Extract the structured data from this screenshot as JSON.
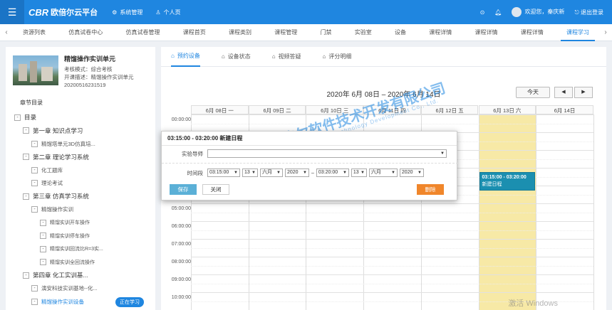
{
  "topbar": {
    "logo_mark": "CBR",
    "logo_text": "欧倍尔云平台",
    "nav": [
      {
        "icon": "gear-icon",
        "label": "系统管理"
      },
      {
        "icon": "user-icon",
        "label": "个人页"
      }
    ],
    "welcome": "欢迎您，秦庆新",
    "logout": "退出登录"
  },
  "tabs": {
    "items": [
      "资源列表",
      "仿真试卷中心",
      "仿真试卷管理",
      "课程首页",
      "课程类别",
      "课程管理",
      "门禁",
      "实验室",
      "设备",
      "课程详情",
      "课程详情",
      "课程详情",
      "课程学习"
    ],
    "active_index": 12
  },
  "course": {
    "title": "精馏操作实训单元",
    "mode_label": "考核模式：",
    "mode_value": "综合考核",
    "desc_label": "开课描述：",
    "desc_value": "精馏操作实训单元",
    "code": "20200516231519"
  },
  "toc": {
    "label": "章节目录",
    "studying_badge": "正在学习",
    "items": [
      {
        "level": 0,
        "box": "-",
        "label": "目录"
      },
      {
        "level": 1,
        "box": "-",
        "label": "第一章 知识点学习"
      },
      {
        "level": 2,
        "box": "-",
        "label": "精馏塔单元3D仿真培..."
      },
      {
        "level": 1,
        "box": "-",
        "label": "第二章 理论学习系统"
      },
      {
        "level": 2,
        "box": "-",
        "label": "化工题库"
      },
      {
        "level": 2,
        "box": "-",
        "label": "理论考试"
      },
      {
        "level": 1,
        "box": "-",
        "label": "第三章 仿真学习系统"
      },
      {
        "level": 2,
        "box": "-",
        "label": "精馏操作实训"
      },
      {
        "level": 3,
        "box": "-",
        "label": "精馏实训开车操作"
      },
      {
        "level": 3,
        "box": "-",
        "label": "精馏实训停车操作"
      },
      {
        "level": 3,
        "box": "-",
        "label": "精馏实训回流比R=3实..."
      },
      {
        "level": 3,
        "box": "-",
        "label": "精馏实训全回流操作"
      },
      {
        "level": 1,
        "box": "-",
        "label": "第四章 化工实训基..."
      },
      {
        "level": 2,
        "box": "-",
        "label": "演安科技实训基地--化..."
      },
      {
        "level": 2,
        "box": "-",
        "label": "精馏操作实训设备",
        "active": true
      }
    ]
  },
  "subtabs": [
    {
      "icon": "home-icon",
      "label": "预约设备"
    },
    {
      "icon": "home-icon",
      "label": "设备状态"
    },
    {
      "icon": "home-icon",
      "label": "视频答疑"
    },
    {
      "icon": "home-icon",
      "label": "评分明细"
    }
  ],
  "calendar": {
    "title": "2020年 6月 08日 – 2020年 6月 14日",
    "today": "今天",
    "prev": "◀",
    "next": "▶",
    "days": [
      "6月 08日 一",
      "6月 09日 二",
      "6月 10日 三",
      "6月 11日 四",
      "6月 12日 五",
      "6月 13日 六",
      "6月 14日"
    ],
    "highlight_day_index": 5,
    "times": [
      "00:00:00",
      "01:00:00",
      "02:00:00",
      "03:00:00",
      "04:00:00",
      "05:00:00",
      "06:00:00",
      "07:00:00",
      "08:00:00",
      "09:00:00",
      "10:00:00"
    ],
    "event": {
      "time": "03:15:00 - 03:20:00",
      "title": "新建日程",
      "day_index": 5
    }
  },
  "dialog": {
    "title": "03:15:00 - 03:20:00   新建日程",
    "instructor_label": "实验导师",
    "instructor_value": "",
    "period_label": "时间段",
    "start_time": "03:15:00",
    "start_day": "13",
    "start_month": "六月",
    "start_year": "2020",
    "tilde": "–",
    "end_time": "03:20:00",
    "end_day": "13",
    "end_month": "六月",
    "end_year": "2020",
    "save": "保存",
    "close": "关闭",
    "delete": "删除"
  },
  "watermark": {
    "logo": "OBR",
    "company": "北京欧倍尔软件技术开发有限公司",
    "company_en": "Beijing Oubeier Software Technology Development Co., Ltd."
  },
  "windows_watermark": "激活 Windows",
  "colors": {
    "primary": "#1f86e0",
    "highlight": "#f7e9a6",
    "event": "#1b8fb0",
    "delete": "#f0862b",
    "save": "#5bb0d7"
  }
}
